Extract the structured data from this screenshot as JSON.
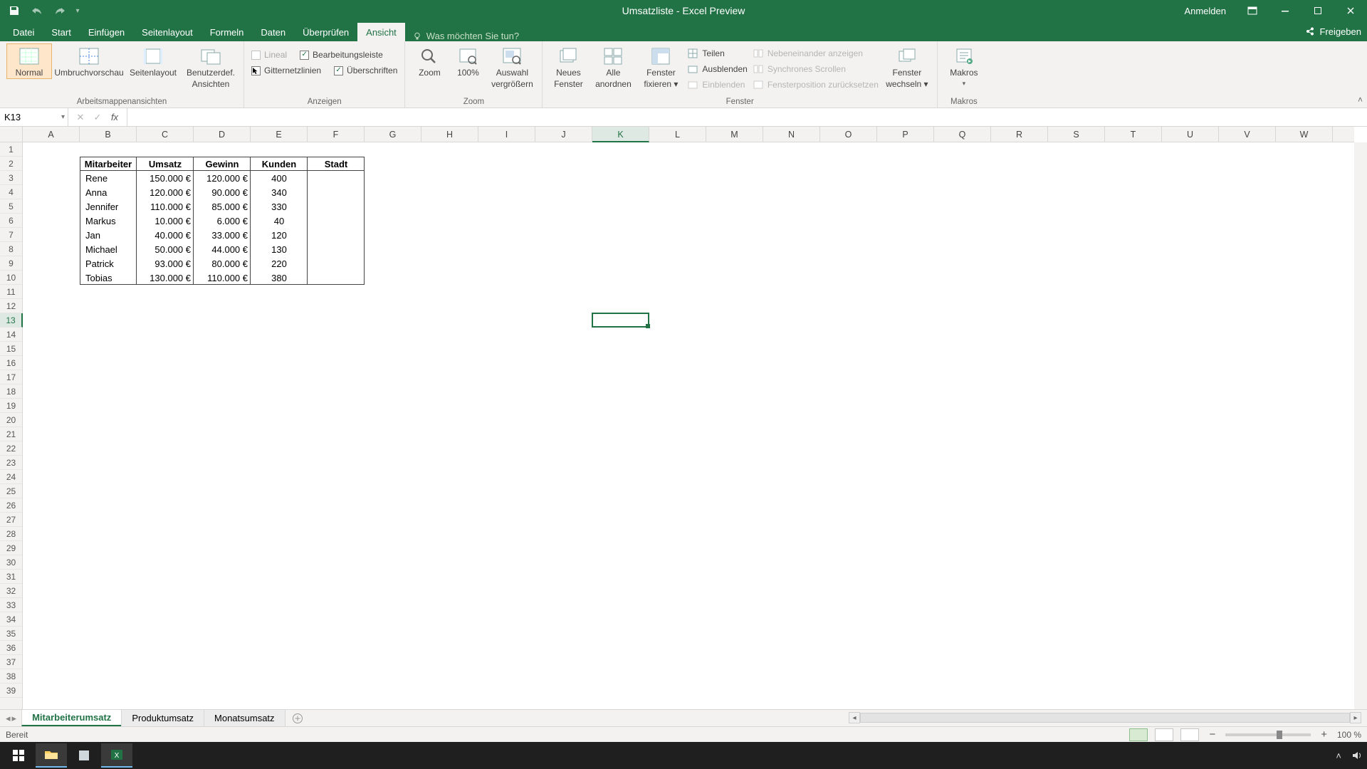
{
  "title": "Umsatzliste  -  Excel Preview",
  "account": "Anmelden",
  "share": "Freigeben",
  "tellme_placeholder": "Was möchten Sie tun?",
  "tabs": [
    "Datei",
    "Start",
    "Einfügen",
    "Seitenlayout",
    "Formeln",
    "Daten",
    "Überprüfen",
    "Ansicht"
  ],
  "active_tab": "Ansicht",
  "ribbon": {
    "views": {
      "label": "Arbeitsmappenansichten",
      "normal": "Normal",
      "umbruch": "Umbruchvorschau",
      "seitenlayout": "Seitenlayout",
      "benutzer_l1": "Benutzerdef.",
      "benutzer_l2": "Ansichten"
    },
    "anzeigen": {
      "label": "Anzeigen",
      "lineal": "Lineal",
      "bearbeitungsleiste": "Bearbeitungsleiste",
      "gitternetz": "Gitternetzlinien",
      "ueberschriften": "Überschriften"
    },
    "zoom": {
      "label": "Zoom",
      "zoom": "Zoom",
      "p100": "100%",
      "auswahl_l1": "Auswahl",
      "auswahl_l2": "vergrößern"
    },
    "fenster": {
      "label": "Fenster",
      "neues_l1": "Neues",
      "neues_l2": "Fenster",
      "alle_l1": "Alle",
      "alle_l2": "anordnen",
      "fixieren_l1": "Fenster",
      "fixieren_l2": "fixieren ▾",
      "teilen": "Teilen",
      "ausblenden": "Ausblenden",
      "einblenden": "Einblenden",
      "neben": "Nebeneinander anzeigen",
      "sync": "Synchrones Scrollen",
      "pos": "Fensterposition zurücksetzen",
      "wechseln_l1": "Fenster",
      "wechseln_l2": "wechseln ▾"
    },
    "makros": {
      "label": "Makros",
      "btn": "Makros",
      "dd": "▾"
    }
  },
  "namebox": "K13",
  "fx_label": "fx",
  "columns": [
    "A",
    "B",
    "C",
    "D",
    "E",
    "F",
    "G",
    "H",
    "I",
    "J",
    "K",
    "L",
    "M",
    "N",
    "O",
    "P",
    "Q",
    "R",
    "S",
    "T",
    "U",
    "V",
    "W"
  ],
  "active_col": "K",
  "row_count": 39,
  "active_row": 13,
  "table": {
    "start_col": 1,
    "start_row": 1,
    "headers": [
      "Mitarbeiter",
      "Umsatz",
      "Gewinn",
      "Kunden",
      "Stadt"
    ],
    "rows": [
      [
        "Rene",
        "150.000 €",
        "120.000 €",
        "400",
        ""
      ],
      [
        "Anna",
        "120.000 €",
        "90.000 €",
        "340",
        ""
      ],
      [
        "Jennifer",
        "110.000 €",
        "85.000 €",
        "330",
        ""
      ],
      [
        "Markus",
        "10.000 €",
        "6.000 €",
        "40",
        ""
      ],
      [
        "Jan",
        "40.000 €",
        "33.000 €",
        "120",
        ""
      ],
      [
        "Michael",
        "50.000 €",
        "44.000 €",
        "130",
        ""
      ],
      [
        "Patrick",
        "93.000 €",
        "80.000 €",
        "220",
        ""
      ],
      [
        "Tobias",
        "130.000 €",
        "110.000 €",
        "380",
        ""
      ]
    ]
  },
  "sheets": [
    "Mitarbeiterumsatz",
    "Produktumsatz",
    "Monatsumsatz"
  ],
  "active_sheet": 0,
  "status": "Bereit",
  "zoom_pct": "100 %"
}
